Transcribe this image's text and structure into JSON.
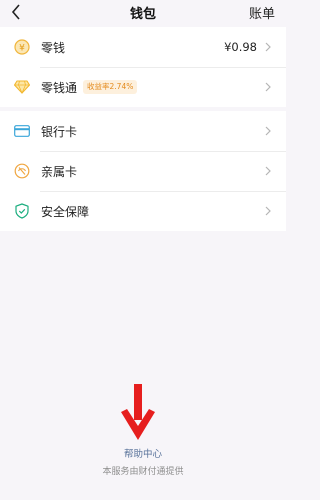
{
  "header": {
    "title": "钱包",
    "bill_label": "账单"
  },
  "group1": [
    {
      "label": "零钱",
      "value": "¥0.98",
      "icon": "coin-icon"
    },
    {
      "label": "零钱通",
      "badge": "收益率2.74%",
      "icon": "diamond-icon"
    }
  ],
  "group2": [
    {
      "label": "银行卡",
      "icon": "bank-card-icon"
    },
    {
      "label": "亲属卡",
      "icon": "family-card-icon"
    },
    {
      "label": "安全保障",
      "icon": "shield-icon"
    }
  ],
  "help_label": "帮助中心",
  "footer_text": "本服务由财付通提供",
  "colors": {
    "accent_orange": "#f5a623",
    "accent_teal": "#1aad7e",
    "arrow_red": "#e61e1e",
    "link_blue": "#58729a"
  }
}
